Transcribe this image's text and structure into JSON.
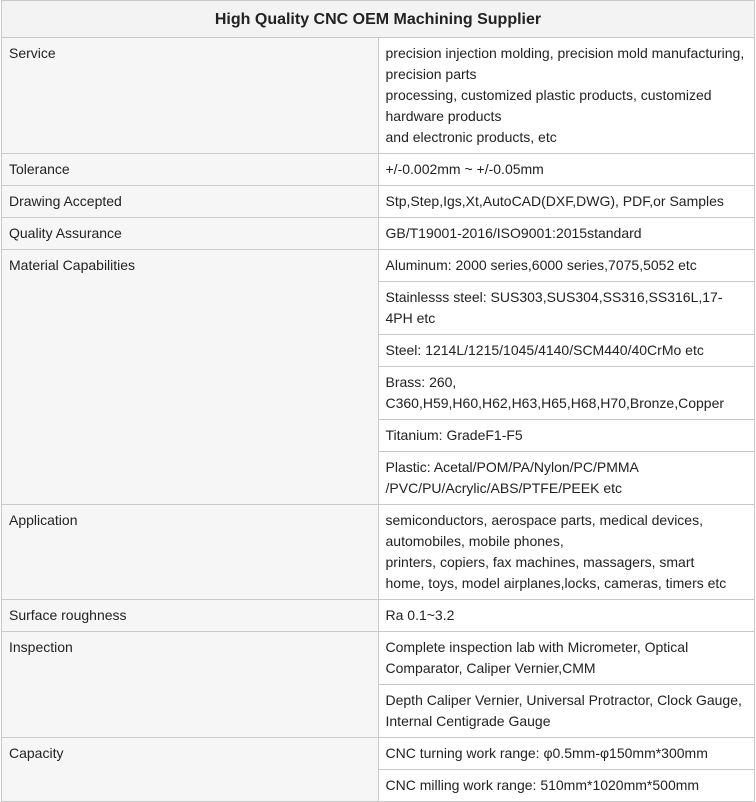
{
  "title": "High Quality CNC OEM Machining Supplier",
  "rows": [
    {
      "label": "Service",
      "values": [
        [
          "precision injection molding, precision mold manufacturing, precision parts",
          "processing, customized plastic products, customized",
          "hardware products",
          "and electronic products, etc"
        ]
      ]
    },
    {
      "label": "Tolerance",
      "values": [
        [
          "+/-0.002mm ~ +/-0.05mm"
        ]
      ]
    },
    {
      "label": "Drawing Accepted",
      "values": [
        [
          "Stp,Step,Igs,Xt,AutoCAD(DXF,DWG), PDF,or Samples"
        ]
      ]
    },
    {
      "label": "Quality Assurance",
      "values": [
        [
          "GB/T19001-2016/ISO9001:2015standard"
        ]
      ]
    },
    {
      "label": "Material Capabilities",
      "values": [
        [
          "Aluminum: 2000 series,6000 series,7075,5052 etc"
        ],
        [
          "Stainlesss steel: SUS303,SUS304,SS316,SS316L,17-4PH etc"
        ],
        [
          "Steel: 1214L/1215/1045/4140/SCM440/40CrMo etc"
        ],
        [
          "Brass: 260, C360,H59,H60,H62,H63,H65,H68,H70,Bronze,Copper"
        ],
        [
          "Titanium: GradeF1-F5"
        ],
        [
          "Plastic: Acetal/POM/PA/Nylon/PC/PMMA /PVC/PU/Acrylic/ABS/PTFE/PEEK etc"
        ]
      ]
    },
    {
      "label": "Application",
      "values": [
        [
          "semiconductors, aerospace parts, medical devices, automobiles, mobile phones,",
          "printers, copiers, fax machines, massagers, smart",
          "home, toys, model airplanes,locks, cameras, timers etc"
        ]
      ]
    },
    {
      "label": "Surface roughness",
      "values": [
        [
          "Ra 0.1~3.2"
        ]
      ]
    },
    {
      "label": "Inspection",
      "values": [
        [
          "Complete inspection lab with Micrometer, Optical Comparator, Caliper Vernier,CMM"
        ],
        [
          "Depth Caliper Vernier, Universal Protractor, Clock Gauge, Internal Centigrade Gauge"
        ]
      ]
    },
    {
      "label": "Capacity",
      "values": [
        [
          "CNC turning work range: φ0.5mm-φ150mm*300mm"
        ],
        [
          "CNC milling work range: 510mm*1020mm*500mm"
        ]
      ]
    }
  ]
}
